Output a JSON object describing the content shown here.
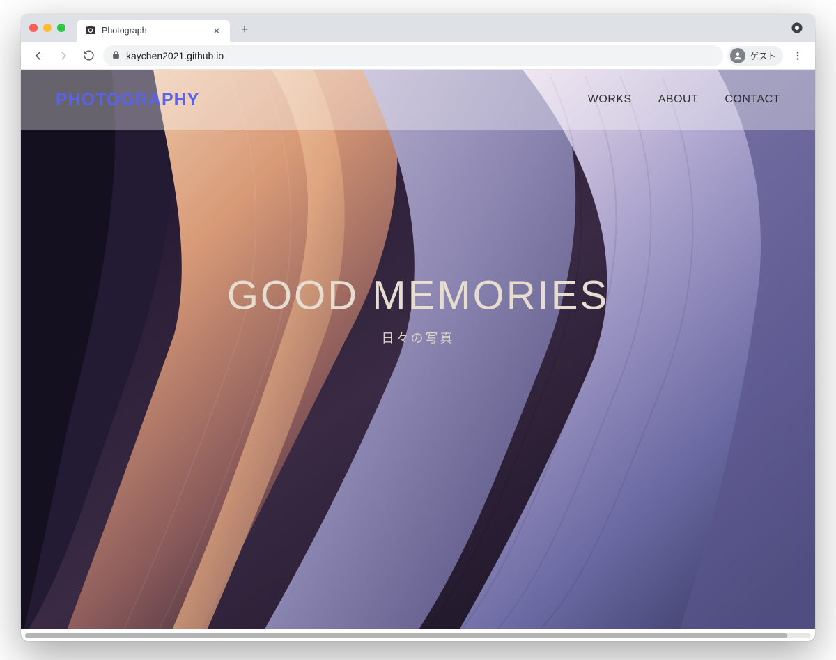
{
  "browser": {
    "tab_title": "Photograph",
    "address": "kaychen2021.github.io",
    "profile_label": "ゲスト"
  },
  "site": {
    "brand": "PHOTOGRAPHY",
    "nav": {
      "works": "WORKS",
      "about": "ABOUT",
      "contact": "CONTACT"
    },
    "hero": {
      "title": "GOOD MEMORIES",
      "subtitle": "日々の写真"
    }
  }
}
